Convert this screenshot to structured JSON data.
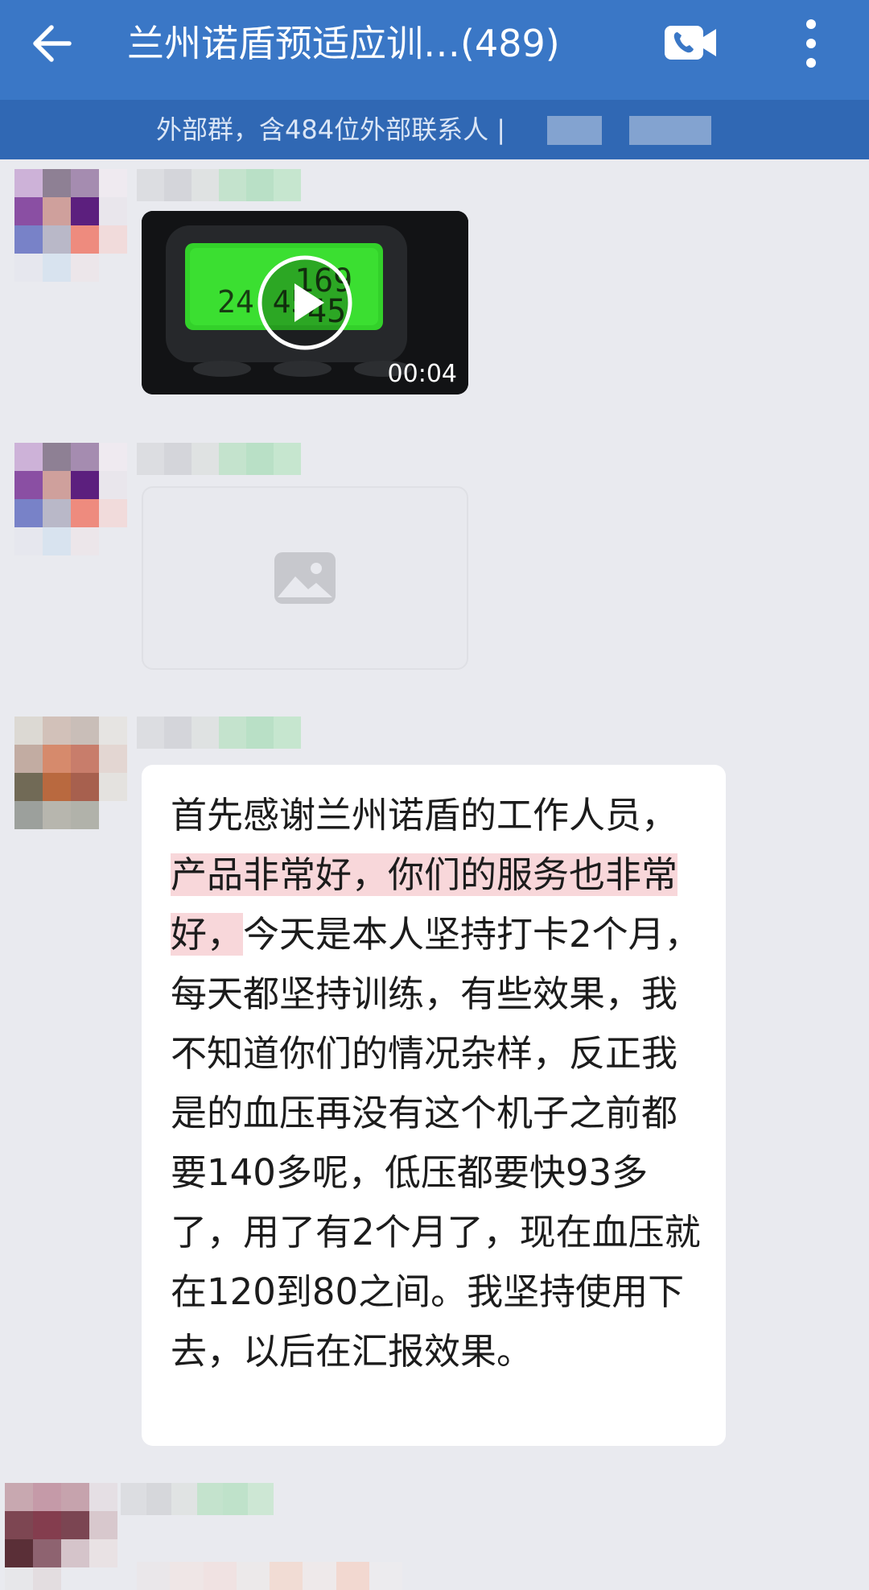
{
  "header": {
    "title": "兰州诺盾预适应训…(489)",
    "subtitle": "外部群，含484位外部联系人 |"
  },
  "messages": [
    {
      "type": "video",
      "duration": "00:04"
    },
    {
      "type": "image"
    },
    {
      "type": "text",
      "segments": [
        {
          "text": "首先感谢兰州诺盾的工作人员，",
          "highlight": false
        },
        {
          "text": "产品非常好，你们的服务也非常好，",
          "highlight": true
        },
        {
          "text": "今天是本人坚持打卡2个月，每天都坚持训练，有些效果，我不知道你们的情况杂样，反正我是的血压再没有这个机子之前都要140多呢，低压都要快93多了，用了有2个月了，现在血压就在120到80之间。我坚持使用下去，以后在汇报效果。",
          "highlight": false
        }
      ]
    }
  ],
  "colors": {
    "appbar": "#3a77c6",
    "subbar": "#3068b4",
    "background": "#e9eaef",
    "highlight": "#f8d7da"
  },
  "icons": [
    "back-arrow-icon",
    "video-call-icon",
    "more-vertical-icon",
    "play-icon",
    "image-icon"
  ]
}
